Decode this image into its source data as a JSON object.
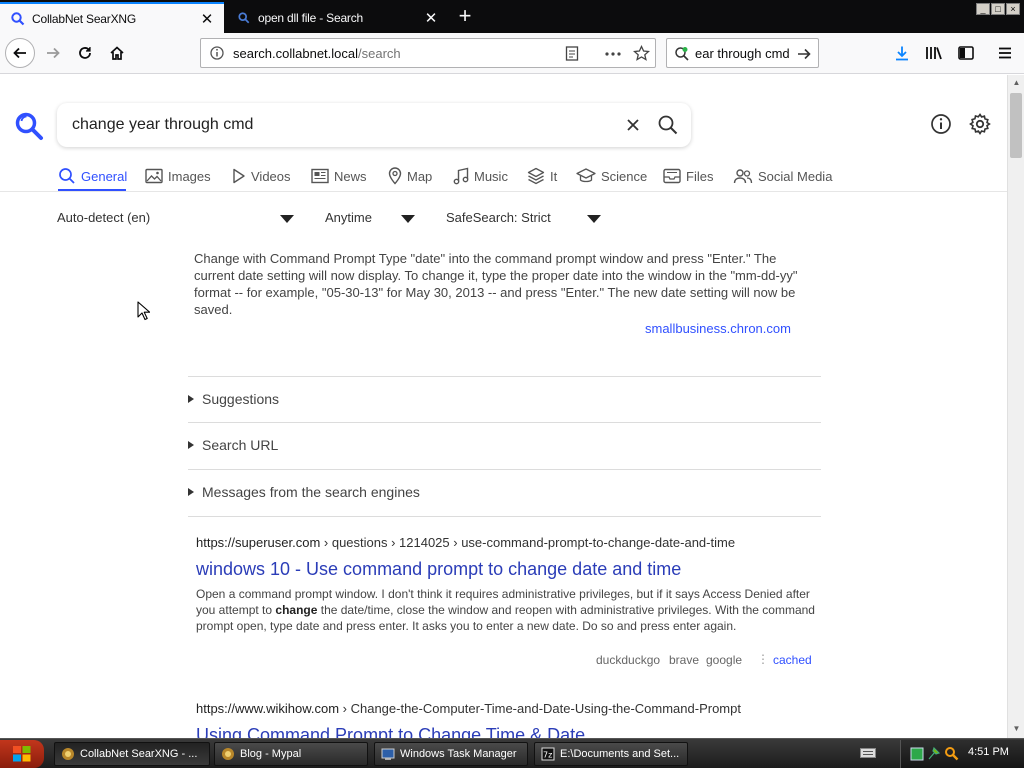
{
  "browser": {
    "tabs": [
      {
        "title": "CollabNet SearXNG",
        "active": true
      },
      {
        "title": "open dll file - Search",
        "active": false
      }
    ],
    "url": {
      "host": "search.collabnet.local",
      "path": "/search"
    },
    "search_box_text": "ear through cmd"
  },
  "page": {
    "query": "change year through cmd",
    "categories": [
      {
        "label": "General",
        "icon": "search-icon",
        "active": true
      },
      {
        "label": "Images",
        "icon": "image-icon"
      },
      {
        "label": "Videos",
        "icon": "play-icon"
      },
      {
        "label": "News",
        "icon": "newspaper-icon"
      },
      {
        "label": "Map",
        "icon": "map-pin-icon"
      },
      {
        "label": "Music",
        "icon": "music-icon"
      },
      {
        "label": "It",
        "icon": "layers-icon"
      },
      {
        "label": "Science",
        "icon": "graduation-cap-icon"
      },
      {
        "label": "Files",
        "icon": "inbox-icon"
      },
      {
        "label": "Social Media",
        "icon": "people-icon"
      }
    ],
    "filters": {
      "language": "Auto-detect (en)",
      "time": "Anytime",
      "safesearch": "SafeSearch: Strict"
    },
    "answer": {
      "text": "Change with Command Prompt Type \"date\" into the command prompt window and press \"Enter.\" The current date setting will now display. To change it, type the proper date into the window in the \"mm-dd-yy\" format -- for example, \"05-30-13\" for May 30, 2013 -- and press \"Enter.\" The new date setting will now be saved.",
      "source": "smallbusiness.chron.com"
    },
    "sections": [
      "Suggestions",
      "Search URL",
      "Messages from the search engines"
    ],
    "results": [
      {
        "host": "https://superuser.com",
        "crumbs": " › questions › 1214025 › use-command-prompt-to-change-date-and-time",
        "title": "windows 10 - Use command prompt to change date and time",
        "snippet_before": "Open a command prompt window. I don't think it requires administrative privileges, but if it says Access Denied after you attempt to ",
        "snippet_bold": "change",
        "snippet_after": " the date/time, close the window and reopen with administrative privileges. With the command prompt open, type date and press enter. It asks you to enter a new date. Do so and press enter again.",
        "engines": [
          "duckduckgo",
          "brave",
          "google"
        ],
        "cached": "cached"
      },
      {
        "host": "https://www.wikihow.com",
        "crumbs": " › Change-the-Computer-Time-and-Date-Using-the-Command-Prompt",
        "title": "Using Command Prompt to Change Time & Date"
      }
    ]
  },
  "taskbar": {
    "tasks": [
      {
        "label": "CollabNet SearXNG - ...",
        "active": true
      },
      {
        "label": "Blog - Mypal"
      },
      {
        "label": "Windows Task Manager"
      },
      {
        "label": "E:\\Documents and Set..."
      }
    ],
    "clock": "4:51 PM"
  },
  "colors": {
    "accent": "#3050ff",
    "link_title": "#2b3db8",
    "firefox_blue": "#0a84ff"
  }
}
